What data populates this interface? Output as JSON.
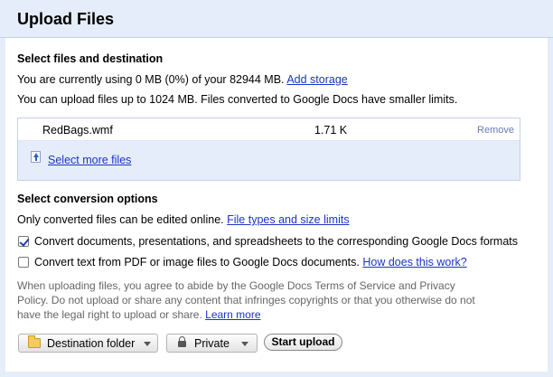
{
  "dialog": {
    "title": "Upload Files"
  },
  "files_section": {
    "heading": "Select files and destination",
    "usage_text": "You are currently using 0 MB (0%) of your 82944 MB.",
    "add_storage_label": "Add storage",
    "limit_text": "You can upload files up to 1024 MB. Files converted to Google Docs have smaller limits."
  },
  "file_list": {
    "items": [
      {
        "name": "RedBags.wmf",
        "size": "1.71 K",
        "remove_label": "Remove"
      }
    ],
    "select_more_label": "Select more files"
  },
  "conversion": {
    "heading": "Select conversion options",
    "info_text": "Only converted files can be edited online.",
    "file_types_label": "File types and size limits",
    "option1_label": "Convert documents, presentations, and spreadsheets to the corresponding Google Docs formats",
    "option1_checked": true,
    "option2_label": "Convert text from PDF or image files to Google Docs documents.",
    "option2_checked": false,
    "how_label": "How does this work?"
  },
  "notice": {
    "text": "When uploading files, you agree to abide by the Google Docs Terms of Service and Privacy Policy. Do not upload or share any content that infringes copyrights or that you otherwise do not have the legal right to upload or share.",
    "learn_more_label": "Learn more"
  },
  "actions": {
    "destination_label": "Destination folder",
    "privacy_label": "Private",
    "start_label": "Start upload"
  },
  "colors": {
    "link": "#1a34c8",
    "panel_bg": "#e6edfa",
    "panel_border": "#c3d1ec"
  },
  "icons": {
    "folder": "folder-icon",
    "lock": "lock-icon",
    "upload": "upload-icon"
  }
}
